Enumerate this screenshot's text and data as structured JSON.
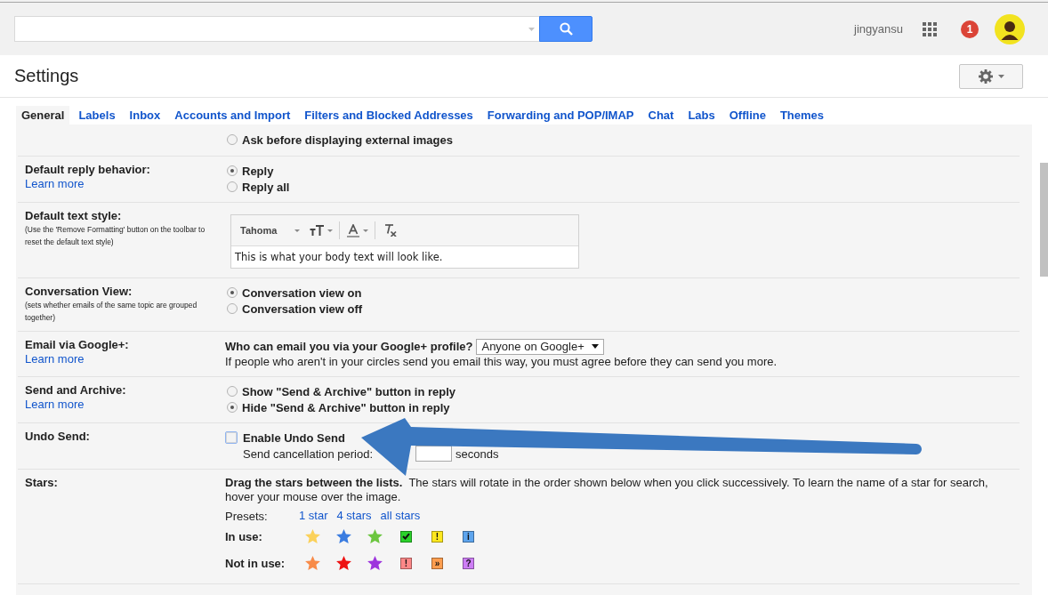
{
  "account": {
    "username": "jingyansu",
    "notifications": "1"
  },
  "page_title": "Settings",
  "tabs": [
    {
      "label": "General",
      "selected": true
    },
    {
      "label": "Labels",
      "selected": false
    },
    {
      "label": "Inbox",
      "selected": false
    },
    {
      "label": "Accounts and Import",
      "selected": false
    },
    {
      "label": "Filters and Blocked Addresses",
      "selected": false
    },
    {
      "label": "Forwarding and POP/IMAP",
      "selected": false
    },
    {
      "label": "Chat",
      "selected": false
    },
    {
      "label": "Labs",
      "selected": false
    },
    {
      "label": "Offline",
      "selected": false
    },
    {
      "label": "Themes",
      "selected": false
    }
  ],
  "settings": [
    {
      "kind": "radios",
      "options": [
        {
          "label": "Ask before displaying external images",
          "selected": false
        }
      ]
    },
    {
      "kind": "radios",
      "label": "Default reply behavior:",
      "link": "Learn more",
      "options": [
        {
          "label": "Reply",
          "selected": true
        },
        {
          "label": "Reply all",
          "selected": false
        }
      ]
    },
    {
      "kind": "text_style",
      "label": "Default text style:",
      "note": "(Use the 'Remove Formatting' button on the toolbar to reset the default text style)",
      "font": "Tahoma",
      "sample": "This is what your body text will look like."
    },
    {
      "kind": "radios",
      "label": "Conversation View:",
      "note": "(sets whether emails of the same topic are grouped together)",
      "options": [
        {
          "label": "Conversation view on",
          "selected": true
        },
        {
          "label": "Conversation view off",
          "selected": false
        }
      ]
    },
    {
      "kind": "select",
      "label": "Email via Google+:",
      "link": "Learn more",
      "question": "Who can email you via your Google+ profile?",
      "value": "Anyone on Google+",
      "description": "If people who aren't in your circles send you email this way, you must agree before they can send you more."
    },
    {
      "kind": "radios",
      "label": "Send and Archive:",
      "link": "Learn more",
      "options": [
        {
          "label": "Show \"Send & Archive\" button in reply",
          "selected": false
        },
        {
          "label": "Hide \"Send & Archive\" button in reply",
          "selected": true
        }
      ]
    },
    {
      "kind": "checkbox",
      "label": "Undo Send:",
      "option": {
        "label": "Enable Undo Send",
        "checked": false
      },
      "period_label": "Send cancellation period:",
      "period_unit": "seconds"
    },
    {
      "kind": "stars",
      "label": "Stars:",
      "intro": "**Drag the stars between the lists.**  The stars will rotate in the order shown below when you click successively. To learn the name of a star for search, hover your mouse over the image.",
      "presets_label": "Presets:",
      "presets": [
        "1 star",
        "4 stars",
        "all stars"
      ],
      "in_use_label": "In use:",
      "in_use": [
        {
          "kind": "star",
          "color": "#fbd15a"
        },
        {
          "kind": "star",
          "color": "#3a7ce0"
        },
        {
          "kind": "star",
          "color": "#6cc640"
        },
        {
          "kind": "check",
          "color": "#2ad12a"
        },
        {
          "kind": "exclamation",
          "color": "#ffe81f",
          "glyph": "!"
        },
        {
          "kind": "info",
          "color": "#5ea5ee",
          "glyph": "i"
        }
      ],
      "not_in_use_label": "Not in use:",
      "not_in_use": [
        {
          "kind": "star",
          "color": "#f88b49"
        },
        {
          "kind": "star",
          "color": "#ee1111"
        },
        {
          "kind": "star",
          "color": "#9d34dd"
        },
        {
          "kind": "exclamation",
          "color": "#fc8888",
          "glyph": "!"
        },
        {
          "kind": "guillemet",
          "color": "#ff9e4f",
          "glyph": "»"
        },
        {
          "kind": "question",
          "color": "#cd7ef5",
          "glyph": "?"
        }
      ]
    }
  ],
  "annotation": {
    "kind": "arrow"
  }
}
